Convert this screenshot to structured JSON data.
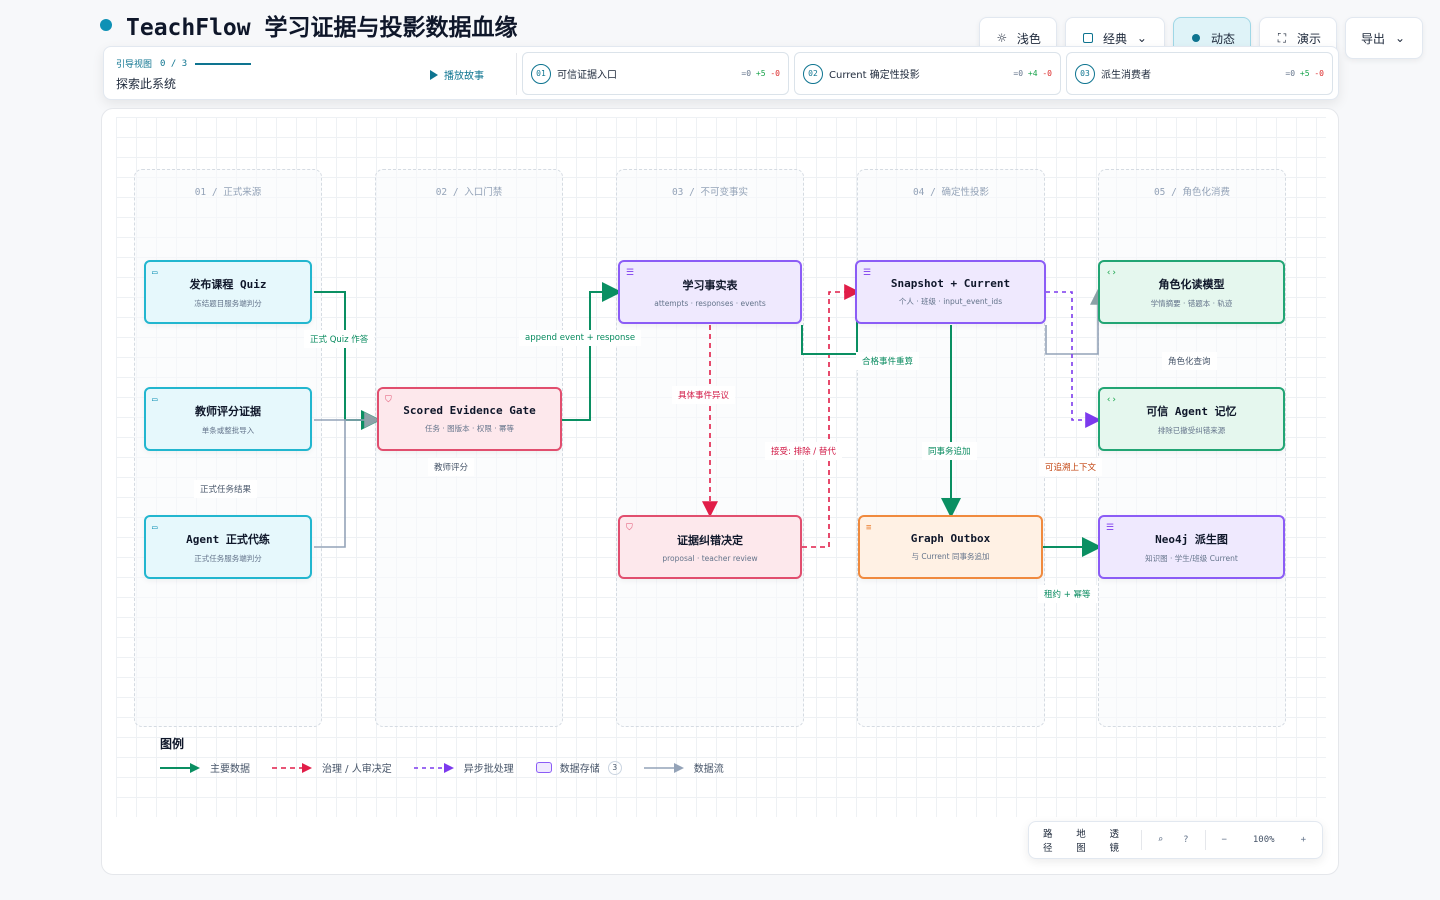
{
  "header": {
    "title": "TeachFlow 学习证据与投影数据血缘"
  },
  "toolbar": {
    "light": "浅色",
    "classic": "经典",
    "dynamic": "动态",
    "present": "演示",
    "export": "导出"
  },
  "guide": {
    "kicker": "引导视图",
    "progress": "0 / 3",
    "subtitle": "探索此系统",
    "play": "播放故事",
    "steps": [
      {
        "num": "01",
        "label": "可信证据入口",
        "eq": "=0",
        "plus": "+5",
        "minus": "-0"
      },
      {
        "num": "02",
        "label": "Current 确定性投影",
        "eq": "=0",
        "plus": "+4",
        "minus": "-0"
      },
      {
        "num": "03",
        "label": "派生消费者",
        "eq": "=0",
        "plus": "+5",
        "minus": "-0"
      }
    ]
  },
  "lanes": [
    "01 / 正式来源",
    "02 / 入口门禁",
    "03 / 不可变事实",
    "04 / 确定性投影",
    "05 / 角色化消费"
  ],
  "nodes": {
    "quiz": {
      "title": "发布课程 Quiz",
      "sub": "冻结题目服务端判分"
    },
    "teacher": {
      "title": "教师评分证据",
      "sub": "单条或整批导入"
    },
    "agent": {
      "title": "Agent 正式代练",
      "sub": "正式任务服务端判分"
    },
    "gate": {
      "title": "Scored Evidence Gate",
      "sub": "任务 · 图版本 · 权限 · 幂等"
    },
    "facts": {
      "title": "学习事实表",
      "sub": "attempts · responses · events"
    },
    "correction": {
      "title": "证据纠错决定",
      "sub": "proposal · teacher review"
    },
    "snapshot": {
      "title": "Snapshot + Current",
      "sub": "个人 · 班级 · input_event_ids"
    },
    "outbox": {
      "title": "Graph Outbox",
      "sub": "与 Current 同事务追加"
    },
    "rolemodel": {
      "title": "角色化读模型",
      "sub": "学情摘要 · 错题本 · 轨迹"
    },
    "memory": {
      "title": "可信 Agent 记忆",
      "sub": "排除已撤受纠错来源"
    },
    "neo4j": {
      "title": "Neo4j 派生图",
      "sub": "知识图 · 学生/班级 Current"
    }
  },
  "edge_labels": {
    "quiz_answer": "正式 Quiz 作答",
    "formal_result": "正式任务结果",
    "teacher_score": "教师评分",
    "append": "append event + response",
    "dispute": "具体事件异议",
    "accept": "接受: 排除 / 替代",
    "recompute": "合格事件重算",
    "same_txn": "同事务追加",
    "role_query": "角色化查询",
    "traceable": "可追溯上下文",
    "lease": "租约 + 幂等"
  },
  "legend": {
    "title": "图例",
    "main": "主要数据",
    "governance": "治理 / 人审决定",
    "async": "异步批处理",
    "store": "数据存储",
    "store_count": "3",
    "flow": "数据流"
  },
  "zoom": {
    "path": "路径",
    "map": "地图",
    "lens": "透镜",
    "level": "100%",
    "minus": "−",
    "plus": "+"
  },
  "colors": {
    "green": "#0a8f62",
    "red": "#e11d48",
    "purple": "#7c3aed",
    "gray": "#94a3b8",
    "accent": "#0e7490"
  }
}
